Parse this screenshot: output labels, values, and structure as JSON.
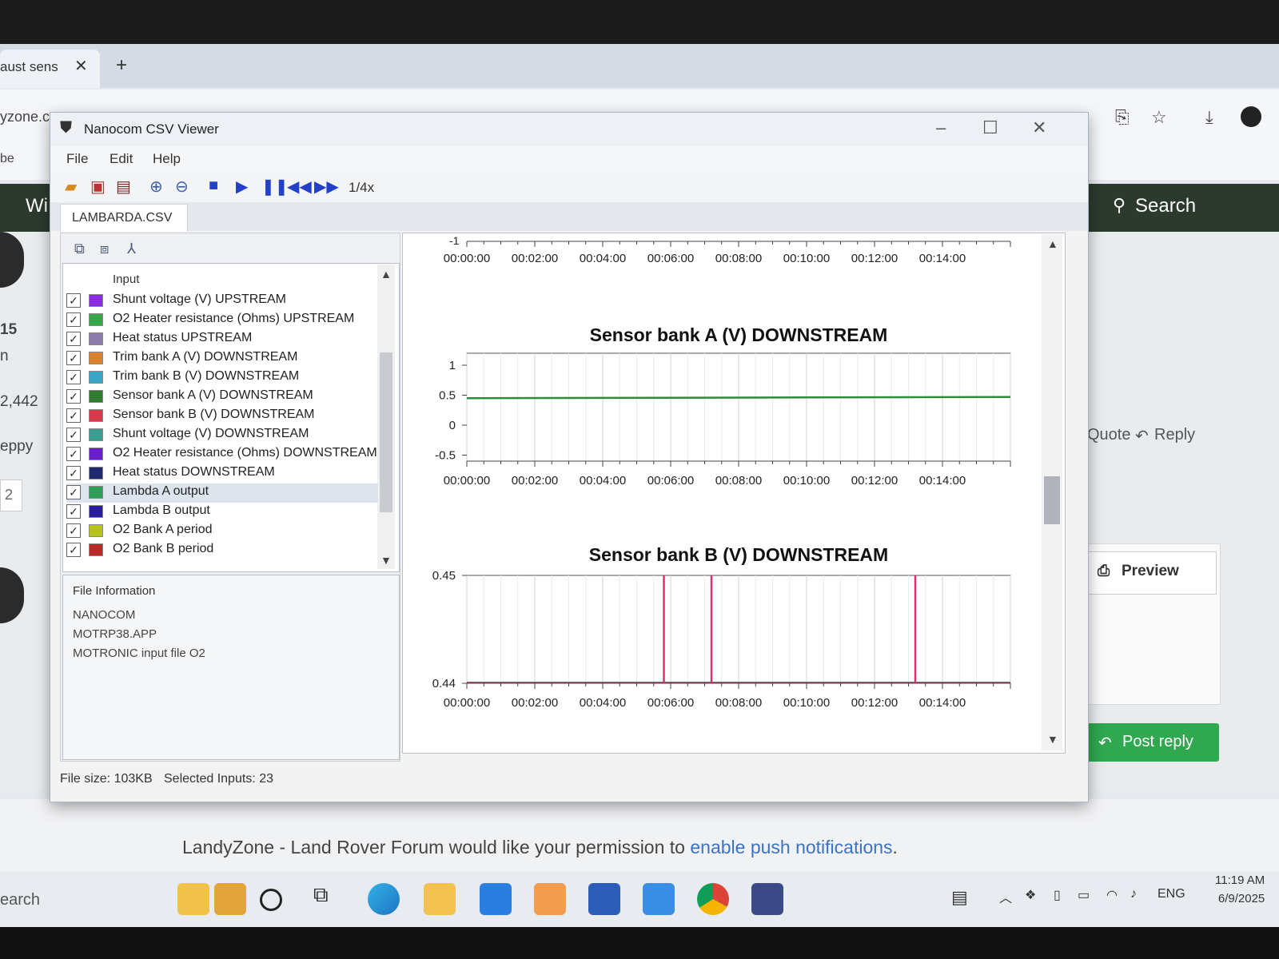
{
  "browser": {
    "tab_label": "aust sens",
    "tab_close": "✕",
    "new_tab": "+",
    "address_partial": "yzone.c",
    "bookmark_partial": "be"
  },
  "forum": {
    "header_partial": "Wi",
    "search_label": "Search",
    "side_texts": [
      "15",
      "n",
      "2,442",
      "eppy",
      "2"
    ],
    "quote_label": "Quote",
    "reply_label": "Reply",
    "preview_label": "Preview",
    "post_reply_label": "Post reply",
    "push_text_prefix": "LandyZone - Land Rover Forum would like your permission to ",
    "push_link": "enable push notifications",
    "push_text_suffix": "."
  },
  "window": {
    "title": "Nanocom CSV Viewer",
    "menu": [
      "File",
      "Edit",
      "Help"
    ],
    "speed": "1/4x",
    "file_tab": "LAMBARDA.CSV",
    "input_header": "Input",
    "inputs": [
      {
        "label": "Shunt voltage (V) UPSTREAM",
        "color": "#8b2be2",
        "checked": true
      },
      {
        "label": "O2 Heater resistance (Ohms) UPSTREAM",
        "color": "#3aa64a",
        "checked": true
      },
      {
        "label": "Heat status UPSTREAM",
        "color": "#8c7aa8",
        "checked": true
      },
      {
        "label": "Trim bank A (V) DOWNSTREAM",
        "color": "#d9822b",
        "checked": true
      },
      {
        "label": "Trim bank B (V) DOWNSTREAM",
        "color": "#39a8c8",
        "checked": true
      },
      {
        "label": "Sensor bank A (V) DOWNSTREAM",
        "color": "#2e7d32",
        "checked": true
      },
      {
        "label": "Sensor bank B (V) DOWNSTREAM",
        "color": "#d83b4c",
        "checked": true
      },
      {
        "label": "Shunt voltage (V) DOWNSTREAM",
        "color": "#3b9e94",
        "checked": true
      },
      {
        "label": "O2 Heater resistance (Ohms) DOWNSTREAM",
        "color": "#6a1fd0",
        "checked": true
      },
      {
        "label": "Heat status DOWNSTREAM",
        "color": "#1e2a6e",
        "checked": true
      },
      {
        "label": "Lambda A output",
        "color": "#2e9e5a",
        "checked": true
      },
      {
        "label": "Lambda B output",
        "color": "#2a1e9e",
        "checked": true
      },
      {
        "label": "O2 Bank A period",
        "color": "#b5c21e",
        "checked": true
      },
      {
        "label": "O2 Bank B period",
        "color": "#b82a2a",
        "checked": true
      }
    ],
    "file_info": {
      "header": "File Information",
      "lines": [
        "NANOCOM",
        "MOTRP38.APP",
        "MOTRONIC input file O2"
      ]
    },
    "status": {
      "file_size": "File size: 103KB",
      "selected_inputs": "Selected Inputs: 23"
    }
  },
  "taskbar": {
    "search_partial": "earch",
    "lang": "ENG",
    "time": "11:19 AM",
    "date": "6/9/2025"
  },
  "chart_data": [
    {
      "type": "line",
      "title": "",
      "x_ticks": [
        "00:00:00",
        "00:02:00",
        "00:04:00",
        "00:06:00",
        "00:08:00",
        "00:10:00",
        "00:12:00",
        "00:14:00"
      ],
      "y_ticks": [
        "-1"
      ],
      "series": []
    },
    {
      "type": "line",
      "title": "Sensor bank A (V) DOWNSTREAM",
      "x_ticks": [
        "00:00:00",
        "00:02:00",
        "00:04:00",
        "00:06:00",
        "00:08:00",
        "00:10:00",
        "00:12:00",
        "00:14:00"
      ],
      "y_ticks": [
        "1",
        "0.5",
        "0",
        "-0.5"
      ],
      "ylim": [
        -0.6,
        1.2
      ],
      "xlim_minutes": [
        0,
        16
      ],
      "series": [
        {
          "color": "#2e8b3a",
          "x_minutes": [
            0,
            16
          ],
          "y": [
            0.45,
            0.47
          ]
        }
      ]
    },
    {
      "type": "line",
      "title": "Sensor bank B (V) DOWNSTREAM",
      "x_ticks": [
        "00:00:00",
        "00:02:00",
        "00:04:00",
        "00:06:00",
        "00:08:00",
        "00:10:00",
        "00:12:00",
        "00:14:00"
      ],
      "y_ticks": [
        "0.45",
        "0.44"
      ],
      "ylim": [
        0.44,
        0.45
      ],
      "xlim_minutes": [
        0,
        16
      ],
      "series": [
        {
          "color": "#e0306a",
          "spikes_x_minutes": [
            5.8,
            7.2,
            13.2
          ],
          "baseline": 0.44,
          "peak": 0.45
        }
      ]
    }
  ]
}
